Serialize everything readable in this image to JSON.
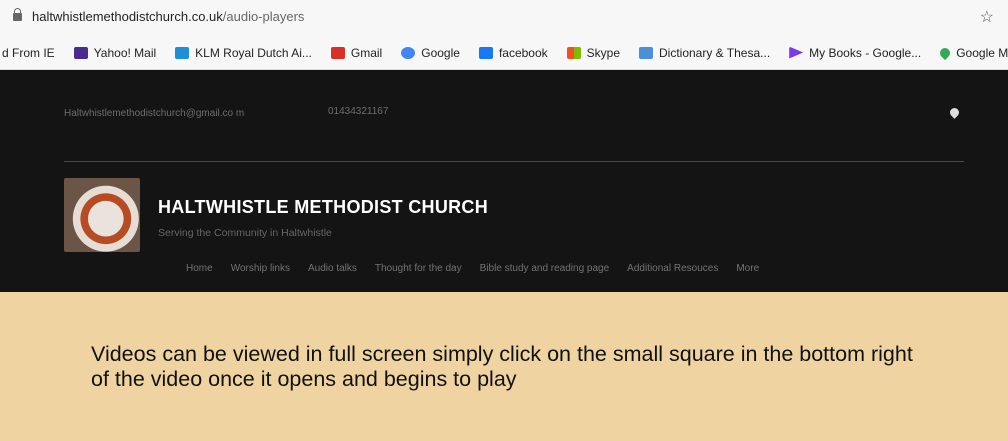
{
  "browser": {
    "url_domain": "haltwhistlemethodistchurch.co.uk",
    "url_path": "/audio-players",
    "bookmarks": [
      {
        "label": "d From IE",
        "icon": "folder-icon",
        "color": "#f2c94c"
      },
      {
        "label": "Yahoo! Mail",
        "icon": "mail-icon",
        "color": "#4b2b8f"
      },
      {
        "label": "KLM Royal Dutch Ai...",
        "icon": "klm-icon",
        "color": "#1d8fd6"
      },
      {
        "label": "Gmail",
        "icon": "gmail-icon",
        "color": "#d93025"
      },
      {
        "label": "Google",
        "icon": "google-icon",
        "color": "#4285f4"
      },
      {
        "label": "facebook",
        "icon": "facebook-icon",
        "color": "#1877f2"
      },
      {
        "label": "Skype",
        "icon": "skype-icon",
        "color": "#f25022"
      },
      {
        "label": "Dictionary & Thesa...",
        "icon": "dictionary-icon",
        "color": "#4b8fd8"
      },
      {
        "label": "My Books - Google...",
        "icon": "play-books-icon",
        "color": "#7c3aed"
      },
      {
        "label": "Google Maps",
        "icon": "maps-pin-icon",
        "color": "#34a853"
      }
    ]
  },
  "site": {
    "email": "Haltwhistlemethodistchurch@gmail.co m",
    "phone": "01434321167",
    "title": "HALTWHISTLE METHODIST CHURCH",
    "subtitle": "Serving the Community in Haltwhistle",
    "nav": [
      "Home",
      "Worship links",
      "Audio talks",
      "Thought for the day",
      "Bible study and reading page",
      "Additional Resouces",
      "More"
    ]
  },
  "content": {
    "message": "Videos can be viewed in full screen simply click on the small square in the bottom right of the video once it opens and begins to play"
  }
}
